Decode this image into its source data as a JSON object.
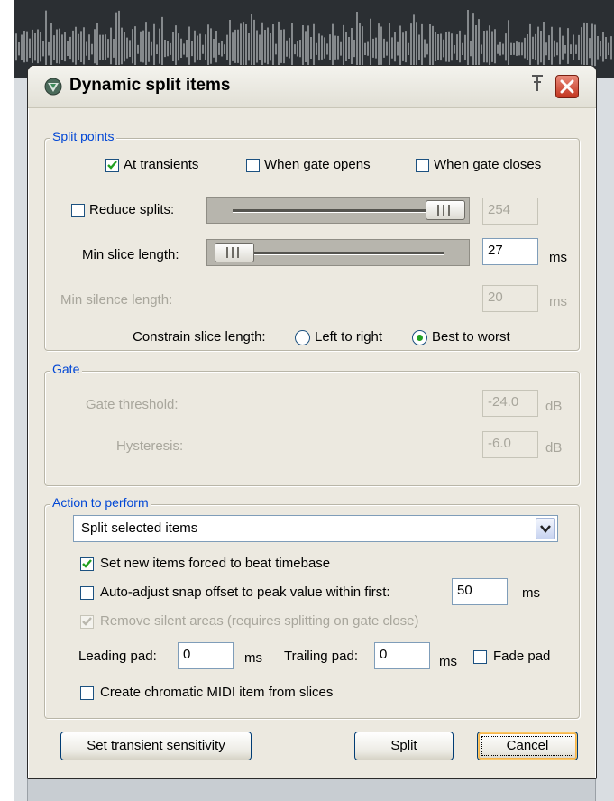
{
  "dialog": {
    "title": "Dynamic split items",
    "icons": {
      "app": "reaper-logo-icon",
      "pin": "pin-icon",
      "close": "close-icon"
    }
  },
  "split_points": {
    "legend": "Split points",
    "at_transients": {
      "label": "At transients",
      "checked": true
    },
    "when_gate_opens": {
      "label": "When gate opens",
      "checked": false
    },
    "when_gate_closes": {
      "label": "When gate closes",
      "checked": false
    },
    "reduce_splits": {
      "label": "Reduce splits:",
      "checked": false,
      "value": "254",
      "slider_level": 0.95
    },
    "min_slice_length": {
      "label": "Min slice length:",
      "value": "27",
      "unit": "ms",
      "slider_level": 0.05
    },
    "min_silence_length": {
      "label": "Min silence length:",
      "value": "20",
      "unit": "ms"
    },
    "constrain": {
      "label": "Constrain slice length:",
      "left_to_right": "Left to right",
      "best_to_worst": "Best to worst",
      "selected": "best_to_worst"
    }
  },
  "gate": {
    "legend": "Gate",
    "threshold": {
      "label": "Gate threshold:",
      "value": "-24.0",
      "unit": "dB"
    },
    "hysteresis": {
      "label": "Hysteresis:",
      "value": "-6.0",
      "unit": "dB"
    }
  },
  "action": {
    "legend": "Action to perform",
    "select_value": "Split selected items",
    "beat_timebase": {
      "label": "Set new items forced to beat timebase",
      "checked": true
    },
    "auto_adjust": {
      "label": "Auto-adjust snap offset to peak value within first:",
      "checked": false,
      "value": "50",
      "unit": "ms"
    },
    "remove_silent": {
      "label": "Remove silent areas (requires splitting on gate close)",
      "checked": true,
      "disabled": true
    },
    "leading_pad": {
      "label": "Leading pad:",
      "value": "0",
      "unit": "ms"
    },
    "trailing_pad": {
      "label": "Trailing pad:",
      "value": "0",
      "unit": "ms"
    },
    "fade_pad": {
      "label": "Fade pad",
      "checked": false
    },
    "chromatic_midi": {
      "label": "Create chromatic MIDI item from slices",
      "checked": false
    }
  },
  "buttons": {
    "transient_sensitivity": "Set transient sensitivity",
    "split": "Split",
    "cancel": "Cancel"
  },
  "colors": {
    "dialog_bg": "#ece9e0",
    "group_label": "#0046d5",
    "checkmark": "#21a121",
    "close_red": "#c3351f"
  }
}
